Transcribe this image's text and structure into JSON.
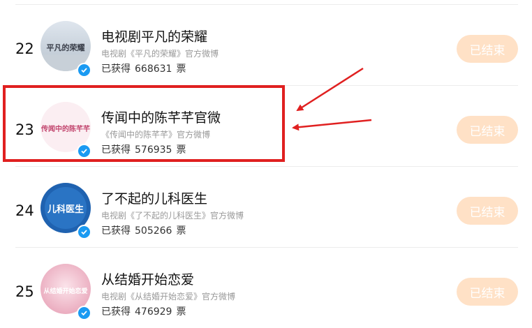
{
  "rows": [
    {
      "rank": "22",
      "title": "电视剧平凡的荣耀",
      "subtitle": "电视剧《平凡的荣耀》官方微博",
      "votes_prefix": "已获得",
      "votes": "668631",
      "votes_unit": "票",
      "status": "已结束",
      "avatar_text": "平凡的荣耀"
    },
    {
      "rank": "23",
      "title": "传闻中的陈芊芊官微",
      "subtitle": "《传闻中的陈芊芊》官方微博",
      "votes_prefix": "已获得",
      "votes": "576935",
      "votes_unit": "票",
      "status": "已结束",
      "avatar_text": "传闻中的陈芊芊"
    },
    {
      "rank": "24",
      "title": "了不起的儿科医生",
      "subtitle": "电视剧《了不起的儿科医生》官方微博",
      "votes_prefix": "已获得",
      "votes": "505266",
      "votes_unit": "票",
      "status": "已结束",
      "avatar_text": "儿科医生"
    },
    {
      "rank": "25",
      "title": "从结婚开始恋爱",
      "subtitle": "电视剧《从结婚开始恋爱》官方微博",
      "votes_prefix": "已获得",
      "votes": "476929",
      "votes_unit": "票",
      "status": "已结束",
      "avatar_text": "从结婚开始恋爱"
    }
  ],
  "colors": {
    "button_bg": "#ffe1c6",
    "highlight": "#e02020",
    "verify": "#1a9af2"
  }
}
